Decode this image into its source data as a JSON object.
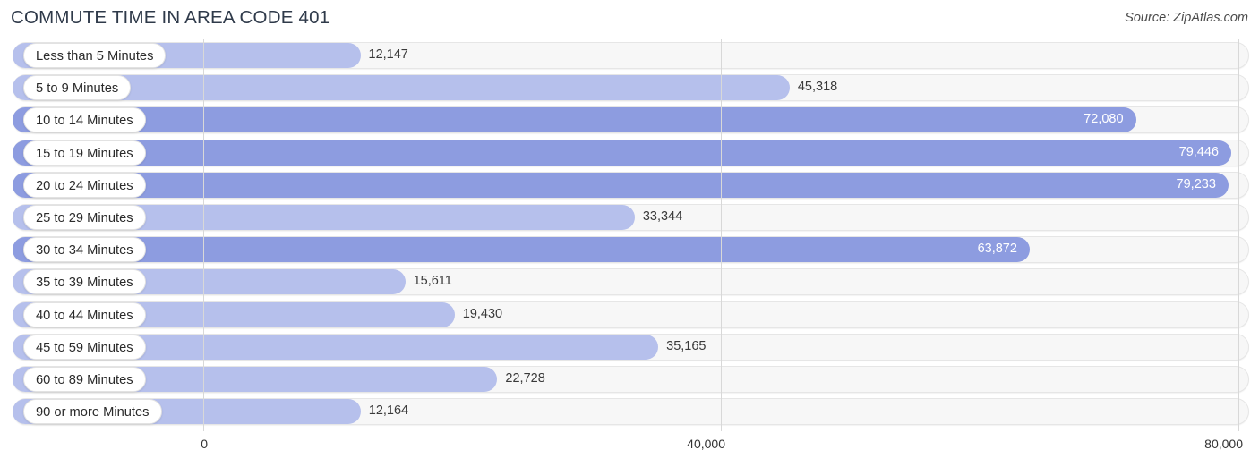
{
  "header": {
    "title": "COMMUTE TIME IN AREA CODE 401",
    "source": "Source: ZipAtlas.com"
  },
  "colors": {
    "bar_light": "#b6c0ec",
    "bar_dark": "#8d9ce0",
    "track": "#f7f7f7",
    "gridline": "#d8d8d8",
    "title": "#2f3a4a"
  },
  "chart_data": {
    "type": "bar",
    "orientation": "horizontal",
    "title": "COMMUTE TIME IN AREA CODE 401",
    "source": "Source: ZipAtlas.com",
    "xlabel": "",
    "ylabel": "",
    "xlim": [
      0,
      80000
    ],
    "grid": true,
    "tick_labels": [
      "0",
      "40,000",
      "80,000"
    ],
    "tick_values": [
      0,
      40000,
      80000
    ],
    "categories": [
      "Less than 5 Minutes",
      "5 to 9 Minutes",
      "10 to 14 Minutes",
      "15 to 19 Minutes",
      "20 to 24 Minutes",
      "25 to 29 Minutes",
      "30 to 34 Minutes",
      "35 to 39 Minutes",
      "40 to 44 Minutes",
      "45 to 59 Minutes",
      "60 to 89 Minutes",
      "90 or more Minutes"
    ],
    "values": [
      12147,
      45318,
      72080,
      79446,
      79233,
      33344,
      63872,
      15611,
      19430,
      35165,
      22728,
      12164
    ],
    "value_labels": [
      "12,147",
      "45,318",
      "72,080",
      "79,446",
      "79,233",
      "33,344",
      "63,872",
      "15,611",
      "19,430",
      "35,165",
      "22,728",
      "12,164"
    ],
    "label_inside": [
      false,
      false,
      true,
      true,
      true,
      false,
      true,
      false,
      false,
      false,
      false,
      false
    ],
    "bar_shades": [
      "light",
      "light",
      "dark",
      "dark",
      "dark",
      "light",
      "dark",
      "light",
      "light",
      "light",
      "light",
      "light"
    ]
  }
}
